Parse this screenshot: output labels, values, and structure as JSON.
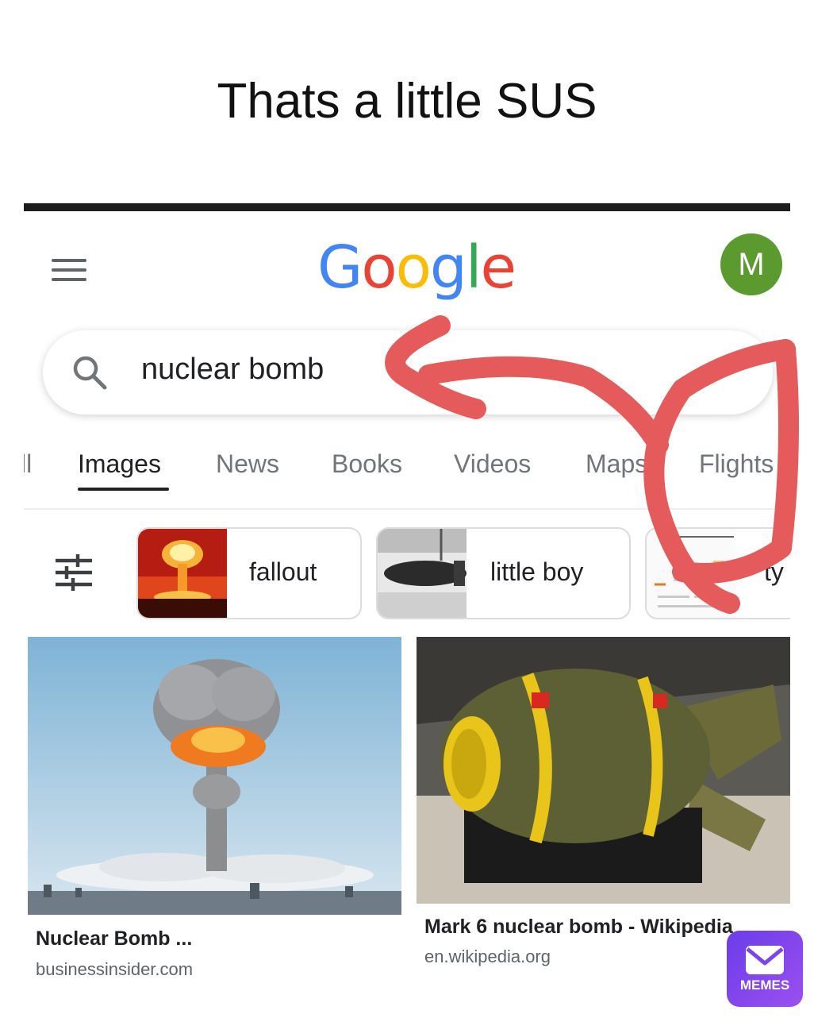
{
  "caption": "Thats a little SUS",
  "header": {
    "logo_letters": [
      {
        "ch": "G",
        "color": "#4285F4"
      },
      {
        "ch": "o",
        "color": "#EA4335"
      },
      {
        "ch": "o",
        "color": "#FBBC05"
      },
      {
        "ch": "g",
        "color": "#4285F4"
      },
      {
        "ch": "l",
        "color": "#34A853"
      },
      {
        "ch": "e",
        "color": "#EA4335"
      }
    ],
    "avatar_letter": "M",
    "menu_icon": "hamburger-icon"
  },
  "search": {
    "query": "nuclear bomb",
    "icon": "search-icon"
  },
  "tabs": [
    {
      "label": "ll",
      "active": false
    },
    {
      "label": "Images",
      "active": true
    },
    {
      "label": "News",
      "active": false
    },
    {
      "label": "Books",
      "active": false
    },
    {
      "label": "Videos",
      "active": false
    },
    {
      "label": "Maps",
      "active": false
    },
    {
      "label": "Flights",
      "active": false
    }
  ],
  "chips": [
    {
      "label": "fallout"
    },
    {
      "label": "little boy"
    },
    {
      "label": "ty"
    }
  ],
  "results": [
    {
      "title": "Nuclear Bomb ...",
      "source": "businessinsider.com"
    },
    {
      "title": "Mark 6 nuclear bomb - Wikipedia",
      "source": "en.wikipedia.org"
    }
  ],
  "watermark": "MEMES",
  "annotation_color": "#E55A5A"
}
